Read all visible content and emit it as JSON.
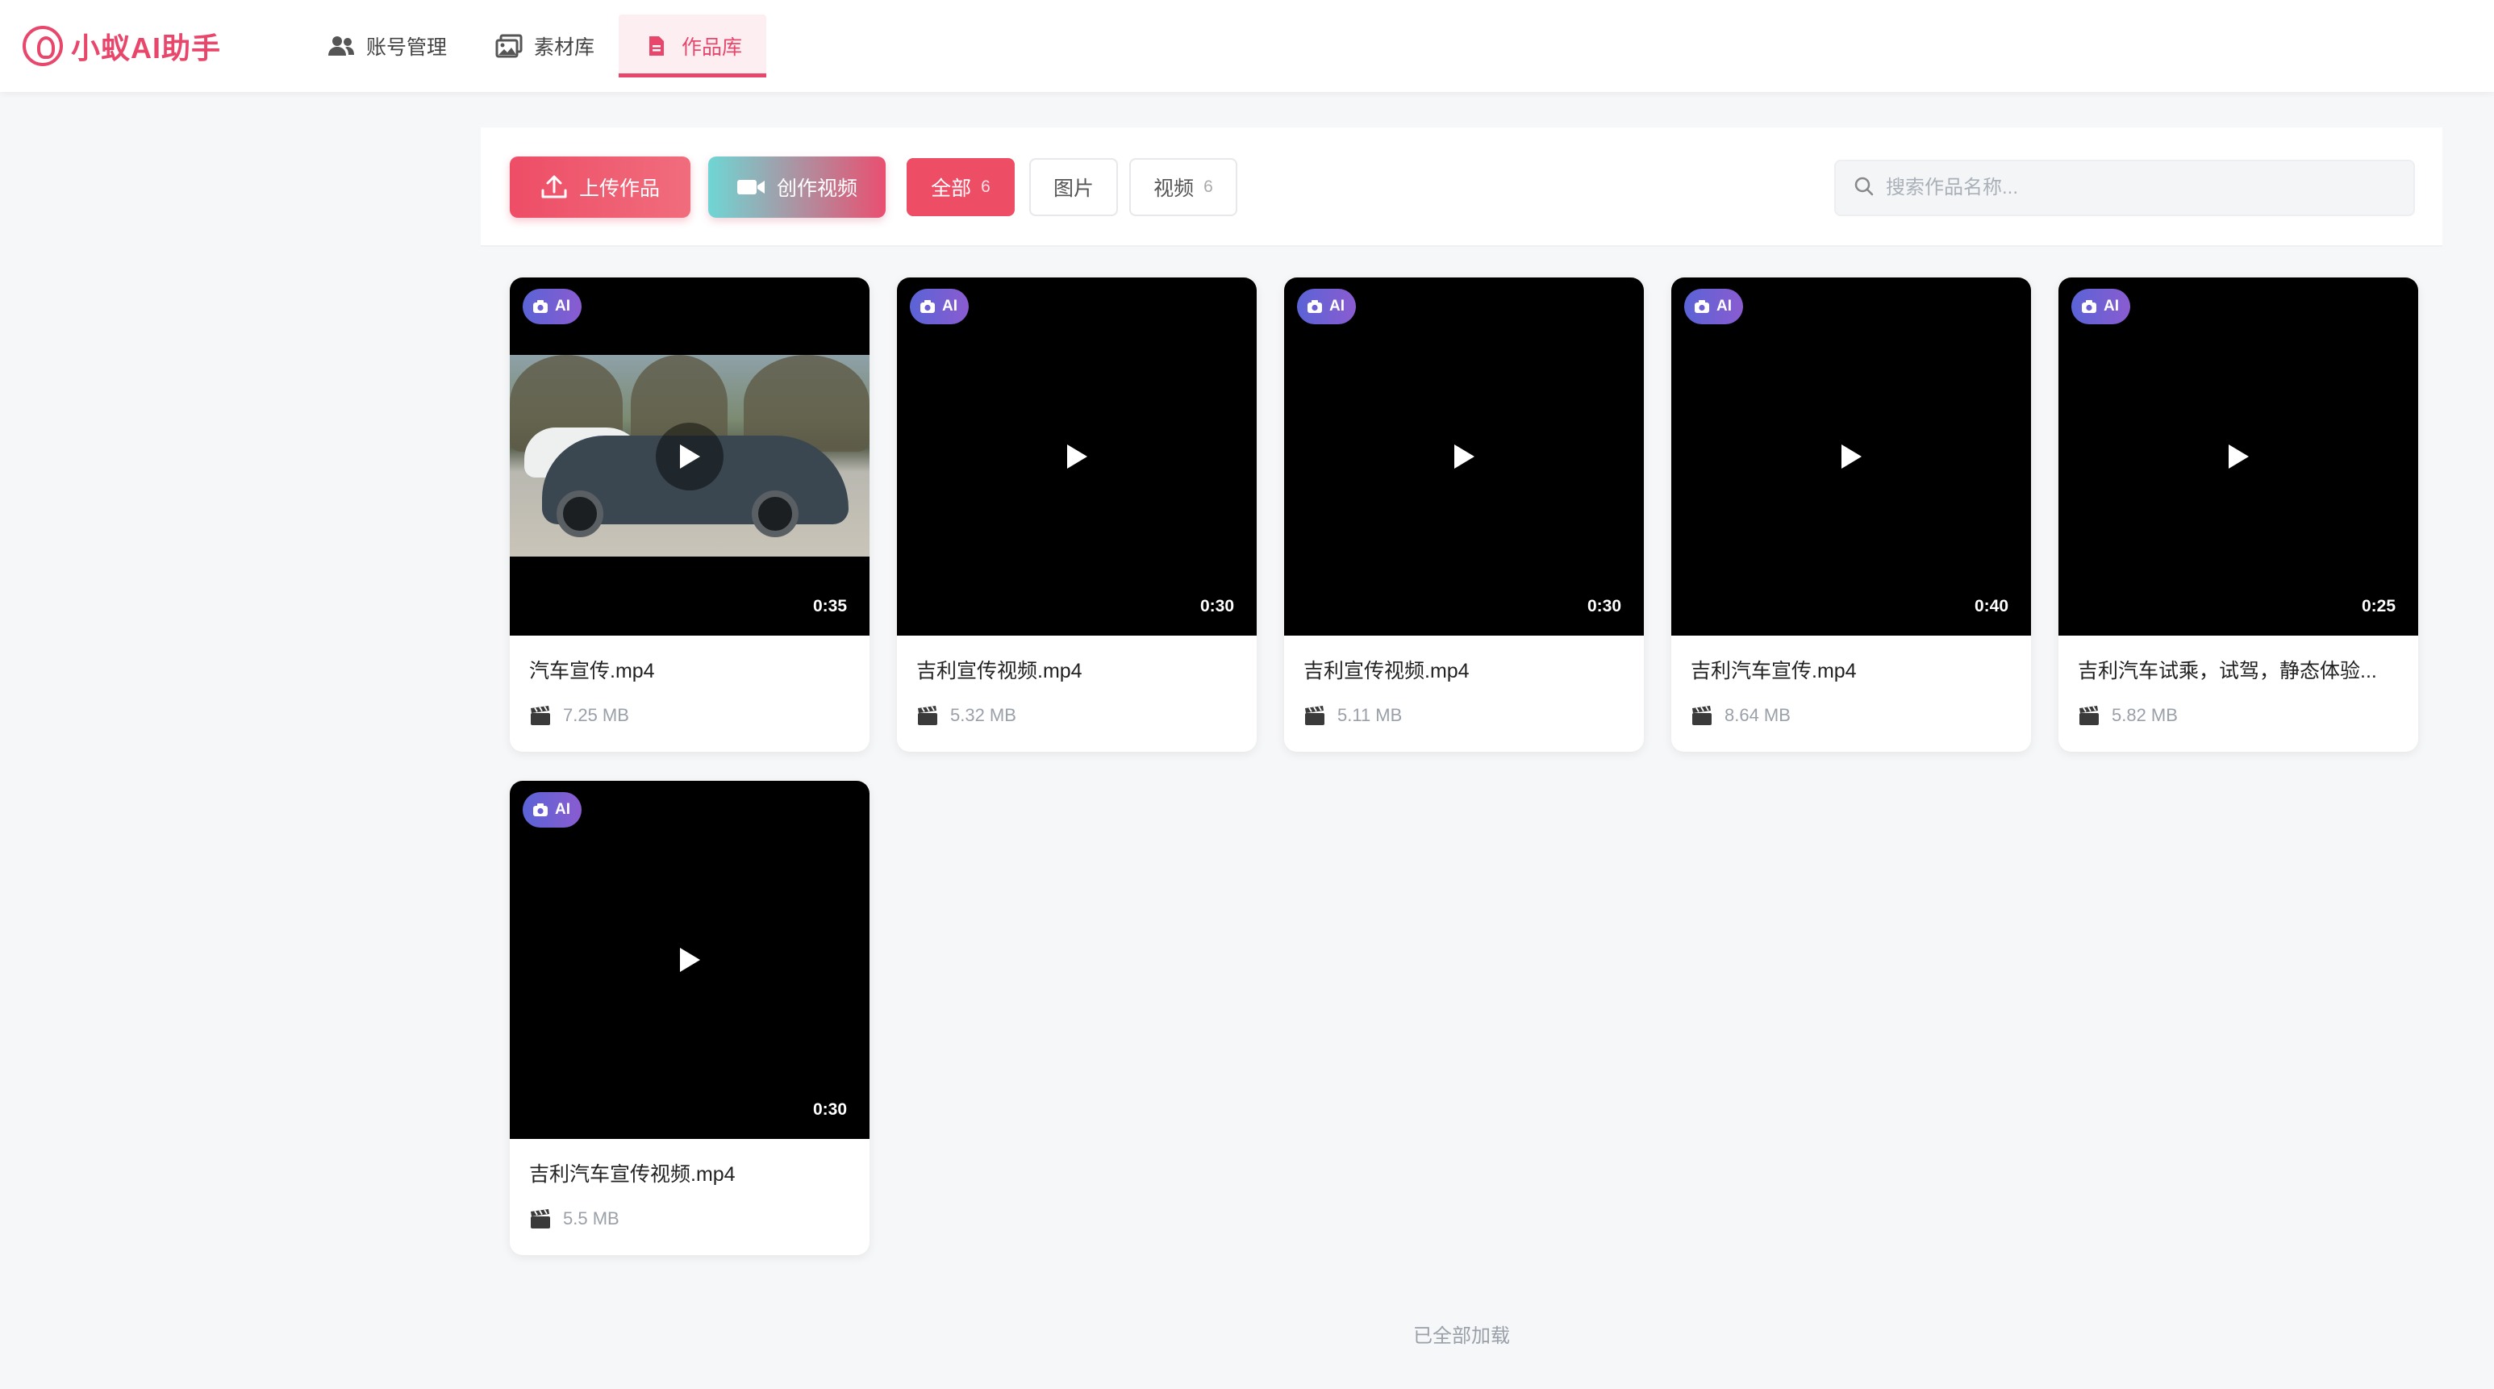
{
  "app": {
    "name": "小蚁AI助手"
  },
  "nav": [
    {
      "label": "账号管理",
      "icon": "users-icon",
      "active": false
    },
    {
      "label": "素材库",
      "icon": "images-icon",
      "active": false
    },
    {
      "label": "作品库",
      "icon": "file-icon",
      "active": true
    }
  ],
  "toolbar": {
    "upload_label": "上传作品",
    "create_label": "创作视频",
    "filters": [
      {
        "label": "全部",
        "count": "6",
        "active": true
      },
      {
        "label": "图片",
        "count": "",
        "active": false
      },
      {
        "label": "视频",
        "count": "6",
        "active": false
      }
    ],
    "search_placeholder": "搜索作品名称...",
    "search_value": ""
  },
  "works": [
    {
      "title": "汽车宣传.mp4",
      "size": "7.25 MB",
      "duration": "0:35",
      "badge": "AI",
      "has_preview": true
    },
    {
      "title": "吉利宣传视频.mp4",
      "size": "5.32 MB",
      "duration": "0:30",
      "badge": "AI",
      "has_preview": false
    },
    {
      "title": "吉利宣传视频.mp4",
      "size": "5.11 MB",
      "duration": "0:30",
      "badge": "AI",
      "has_preview": false
    },
    {
      "title": "吉利汽车宣传.mp4",
      "size": "8.64 MB",
      "duration": "0:40",
      "badge": "AI",
      "has_preview": false
    },
    {
      "title": "吉利汽车试乘，试驾，静态体验...",
      "size": "5.82 MB",
      "duration": "0:25",
      "badge": "AI",
      "has_preview": false
    },
    {
      "title": "吉利汽车宣传视频.mp4",
      "size": "5.5 MB",
      "duration": "0:30",
      "badge": "AI",
      "has_preview": false
    }
  ],
  "footer": {
    "loaded_text": "已全部加载"
  },
  "colors": {
    "accent": "#e8466a",
    "badge": "#6b5fd8",
    "background": "#f6f7f9"
  }
}
